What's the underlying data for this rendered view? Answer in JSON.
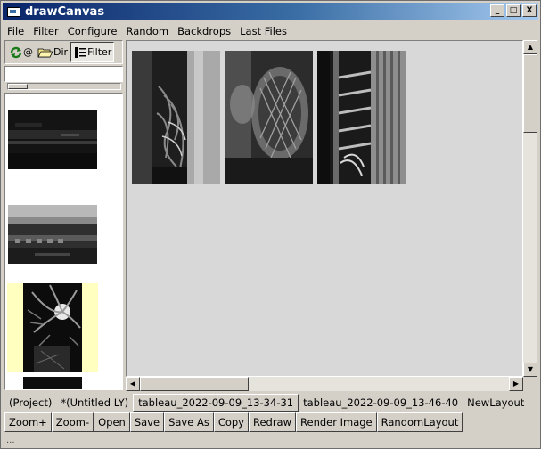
{
  "window": {
    "title": "drawCanvas",
    "controls": {
      "minimize": "_",
      "maximize": "□",
      "close": "X"
    }
  },
  "menu": [
    "File",
    "Filter",
    "Configure",
    "Random",
    "Backdrops",
    "Last Files"
  ],
  "left_toolbar": {
    "refresh_label": "@",
    "dir_label": "Dir",
    "filter_label": "Filter"
  },
  "path_input": {
    "value": ""
  },
  "thumbnail_slider": {
    "position": 0
  },
  "thumbnails": [
    {
      "name": "dark-street-night",
      "selected": false
    },
    {
      "name": "field-with-fence",
      "selected": false
    },
    {
      "name": "palm-leaves-night",
      "selected": true
    }
  ],
  "canvas_photos": [
    {
      "name": "cables-closeup"
    },
    {
      "name": "fan-grille-blur"
    },
    {
      "name": "rack-cables"
    }
  ],
  "layout_tabs": [
    {
      "label": "(Project)",
      "active": false
    },
    {
      "label": "*(Untitled LY)",
      "active": false
    },
    {
      "label": "tableau_2022-09-09_13-34-31",
      "active": true
    },
    {
      "label": "tableau_2022-09-09_13-46-40",
      "active": false
    },
    {
      "label": "NewLayout",
      "active": false
    }
  ],
  "buttons": [
    "Zoom+",
    "Zoom-",
    "Open",
    "Save",
    "Save As",
    "Copy",
    "Redraw",
    "Render Image",
    "RandomLayout"
  ],
  "status": "...",
  "colors": {
    "titlebar_start": "#0a246a",
    "titlebar_end": "#a6caf0",
    "selection": "#ffffc0",
    "canvas_bg": "#d8d8d8"
  },
  "icons": [
    "refresh-icon",
    "folder-open-icon",
    "filter-icon"
  ]
}
